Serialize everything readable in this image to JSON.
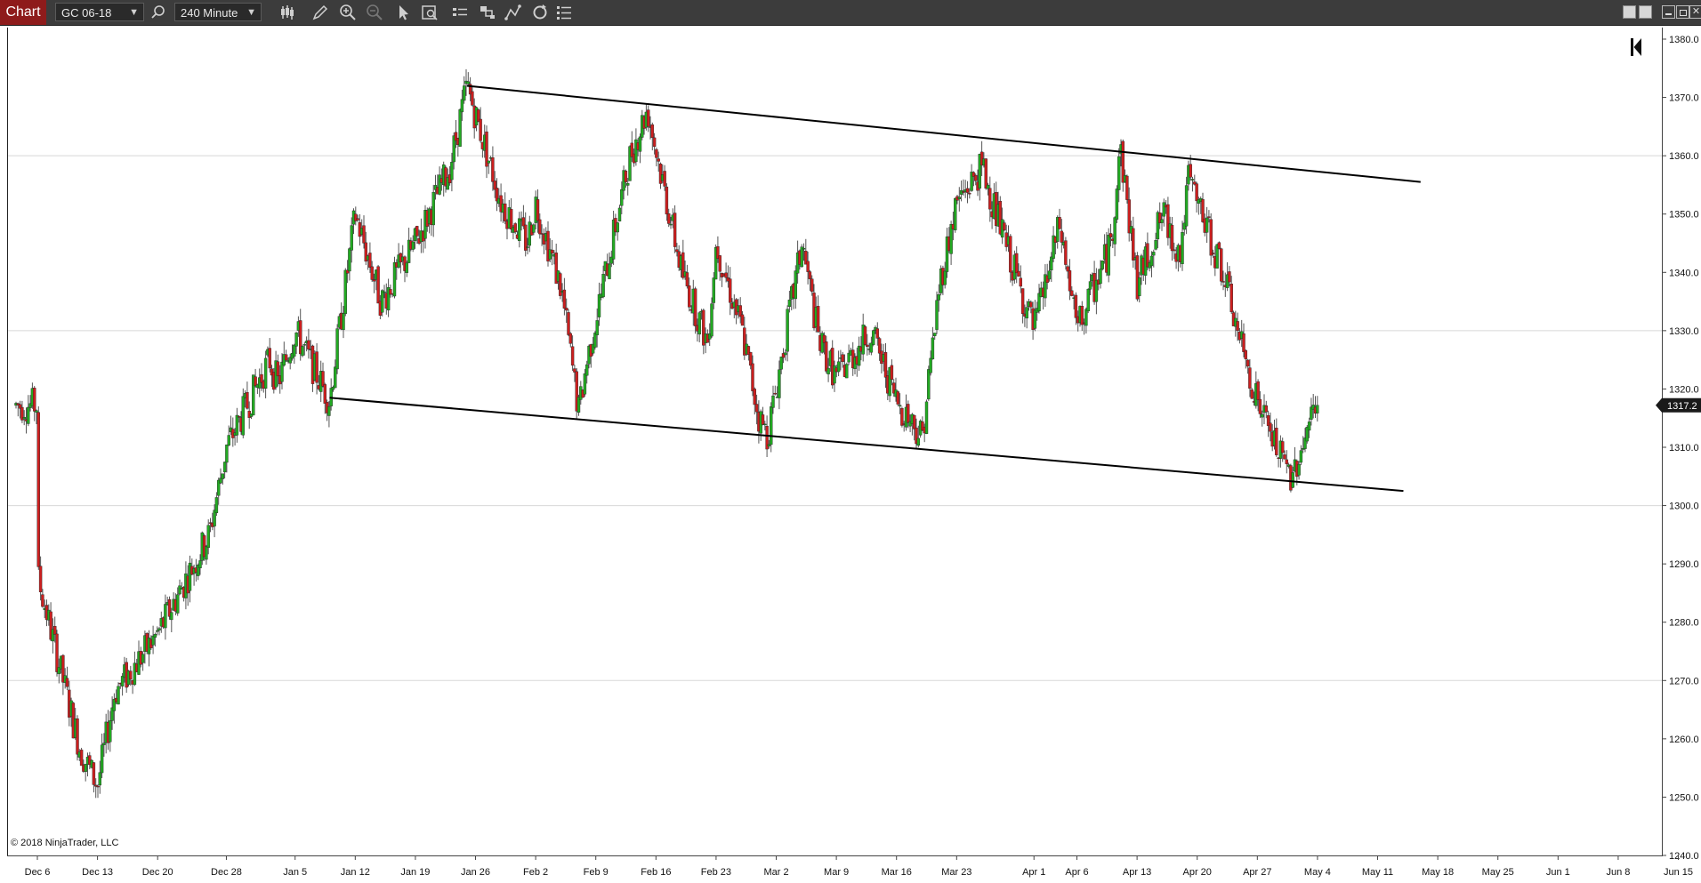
{
  "toolbar": {
    "title": "Chart",
    "instrument": "GC 06-18",
    "interval": "240 Minute",
    "icons": [
      "search-icon",
      "bars-type-icon",
      "pencil-icon",
      "zoom-in-icon",
      "zoom-out-icon",
      "pointer-icon",
      "data-box-icon",
      "properties-icon",
      "strategies-icon",
      "drawing-tools-icon",
      "refresh-icon",
      "list-icon"
    ],
    "window_buttons": [
      "tile-icon",
      "tile-icon",
      "minimize-icon",
      "restore-icon",
      "close-icon"
    ]
  },
  "copyright": "© 2018 NinjaTrader, LLC",
  "current_price_label": "1317.2",
  "colors": {
    "up": "#22aa22",
    "down": "#cc1f1f",
    "wick": "#555555",
    "grid": "#d8d8d8",
    "price_tag": "#1a1a1a"
  },
  "chart_data": {
    "type": "candlestick",
    "interval": "240 Minute",
    "ylim": [
      1240,
      1380
    ],
    "yticks": [
      "1240.0",
      "1250.0",
      "1260.0",
      "1270.0",
      "1280.0",
      "1290.0",
      "1300.0",
      "1310.0",
      "1320.0",
      "1330.0",
      "1340.0",
      "1350.0",
      "1360.0",
      "1370.0",
      "1380.0"
    ],
    "gridlines_y": [
      1270,
      1300,
      1330,
      1360
    ],
    "xticks": [
      "Dec 6",
      "Dec 13",
      "Dec 20",
      "Dec 28",
      "Jan 5",
      "Jan 12",
      "Jan 19",
      "Jan 26",
      "Feb 2",
      "Feb 9",
      "Feb 16",
      "Feb 23",
      "Mar 2",
      "Mar 9",
      "Mar 16",
      "Mar 23",
      "Apr 1",
      "Apr 6",
      "Apr 13",
      "Apr 20",
      "Apr 27",
      "May 4",
      "May 11",
      "May 18",
      "May 25",
      "Jun 1",
      "Jun 8",
      "Jun 15"
    ],
    "last_price": 1317.2,
    "price_path": [
      [
        "Dec 6",
        1288
      ],
      [
        "Dec 8",
        1276
      ],
      [
        "Dec 11",
        1258
      ],
      [
        "Dec 13",
        1252
      ],
      [
        "Dec 15",
        1268
      ],
      [
        "Dec 20",
        1278
      ],
      [
        "Dec 26",
        1295
      ],
      [
        "Dec 28",
        1310
      ],
      [
        "Jan 2",
        1325
      ],
      [
        "Jan 3",
        1321
      ],
      [
        "Jan 5",
        1330
      ],
      [
        "Jan 9",
        1318
      ],
      [
        "Jan 12",
        1350
      ],
      [
        "Jan 15",
        1335
      ],
      [
        "Jan 19",
        1345
      ],
      [
        "Jan 23",
        1358
      ],
      [
        "Jan 25",
        1372
      ],
      [
        "Jan 29",
        1352
      ],
      [
        "Feb 1",
        1345
      ],
      [
        "Feb 2",
        1352
      ],
      [
        "Feb 5",
        1337
      ],
      [
        "Feb 7",
        1316
      ],
      [
        "Feb 8",
        1325
      ],
      [
        "Feb 13",
        1360
      ],
      [
        "Feb 15",
        1368
      ],
      [
        "Feb 19",
        1340
      ],
      [
        "Feb 22",
        1328
      ],
      [
        "Feb 23",
        1345
      ],
      [
        "Feb 26",
        1330
      ],
      [
        "Feb 28",
        1315
      ],
      [
        "Mar 1",
        1312
      ],
      [
        "Mar 5",
        1345
      ],
      [
        "Mar 7",
        1328
      ],
      [
        "Mar 9",
        1322
      ],
      [
        "Mar 13",
        1330
      ],
      [
        "Mar 16",
        1318
      ],
      [
        "Mar 19",
        1312
      ],
      [
        "Mar 21",
        1338
      ],
      [
        "Mar 23",
        1352
      ],
      [
        "Mar 26",
        1358
      ],
      [
        "Mar 28",
        1348
      ],
      [
        "Apr 1",
        1330
      ],
      [
        "Apr 4",
        1348
      ],
      [
        "Apr 6",
        1330
      ],
      [
        "Apr 10",
        1345
      ],
      [
        "Apr 11",
        1362
      ],
      [
        "Apr 13",
        1338
      ],
      [
        "Apr 16",
        1350
      ],
      [
        "Apr 18",
        1343
      ],
      [
        "Apr 19",
        1356
      ],
      [
        "Apr 23",
        1340
      ],
      [
        "Apr 25",
        1328
      ],
      [
        "Apr 27",
        1318
      ],
      [
        "Apr 30",
        1307
      ],
      [
        "May 1",
        1305
      ],
      [
        "May 3",
        1314
      ],
      [
        "May 4",
        1317.2
      ]
    ],
    "trendlines": [
      {
        "name": "upper-channel",
        "from": [
          "Jan 25",
          1372.0
        ],
        "to": [
          "May 16",
          1355.5
        ]
      },
      {
        "name": "lower-channel",
        "from": [
          "Jan 9",
          1318.5
        ],
        "to": [
          "May 14",
          1302.5
        ]
      }
    ],
    "grid": true,
    "legend": "none"
  }
}
